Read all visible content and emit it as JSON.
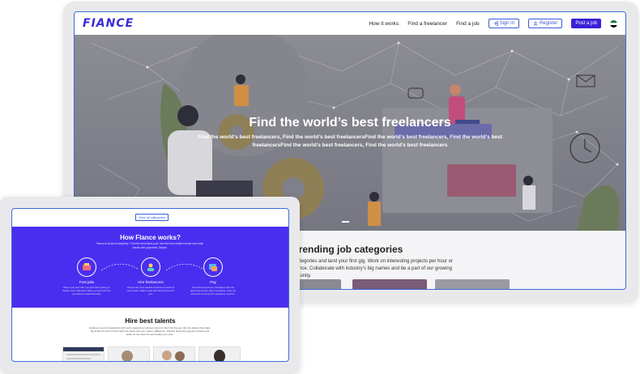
{
  "desktop": {
    "nav": {
      "logo": "FIANCE",
      "links": [
        "How it works",
        "Find a freelancer",
        "Find a job"
      ],
      "sign_in": "Sign in",
      "register": "Register",
      "post_job": "Post a job",
      "flag_colors": [
        "#00732f",
        "#ffffff",
        "#000000",
        "#ff0000"
      ]
    },
    "hero": {
      "title": "Find the world’s best freelancers",
      "subtitle": "Find the world’s best freelancers, Find the world’s best freelancersFind the world’s best freelancers, Find the world’s best freelancersFind the world’s best freelancers, Find the world’s best freelancers"
    },
    "trending": {
      "title": "Trending job categories",
      "text": "job categories and land your first gig. Work on interesting projects per hour or freelance. Collaborate with industry’s big names and be a part of our growing community."
    }
  },
  "tablet": {
    "view_all": "View all categories",
    "how": {
      "title": "How Flance works?",
      "subtitle": "Flance is all about simplicity - Find the best talent pool, hire the best creative heads and make hassle-free payments. Simple.",
      "steps": [
        {
          "title": "Post jobs",
          "desc": "Place a job post with your job brand posting or heavily, enter whichever tasks you can look from job workers instantaneously."
        },
        {
          "title": "Hire freelancers",
          "desc": "Choose the most capable freelancer to work on your project. Make a deal that will work best for you."
        },
        {
          "title": "Pay",
          "desc": "Once the projects are completed, start the approval process. After processing, make the payments securely from anywhere, anytime."
        }
      ]
    },
    "hire": {
      "title": "Hire best talents",
      "subtitle": "Explore a pool of freelancers with work experience looking to land on their first big gig. Hire the places that make big achievers and connect with only those who can make a difference. Discuss about the payment options and settle on one that can accomplish your task."
    }
  },
  "colors": {
    "brand": "#3a2bd4",
    "accent": "#4a2ef0",
    "frame_border": "#3a6bd8"
  }
}
